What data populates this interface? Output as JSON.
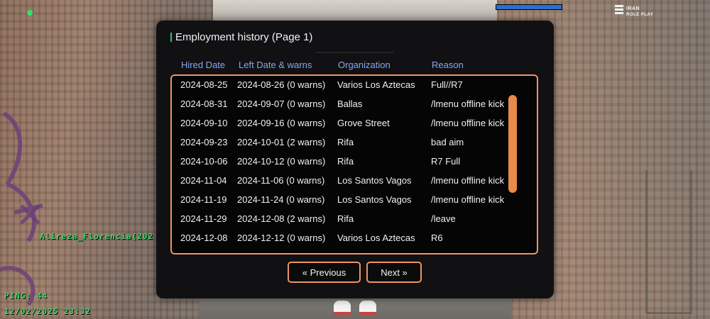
{
  "hud": {
    "player_tag": "Alireza_Florencia(202",
    "ping": "PING: 44",
    "datetime": "12/02/2025 23:32",
    "health_percent": 100,
    "logo_line1": "IRAN",
    "logo_line2": "ROLE PLAY",
    "health_color": "#2b6fd1",
    "hud_text_color": "#3ee06a"
  },
  "dialog": {
    "title": "Employment history (Page 1)",
    "columns": [
      "Hired Date",
      "Left Date & warns",
      "Organization",
      "Reason"
    ],
    "rows": [
      {
        "hired": "2024-08-25",
        "left": "2024-08-26 (0 warns)",
        "org": "Varios Los Aztecas",
        "reason": "Full//R7"
      },
      {
        "hired": "2024-08-31",
        "left": "2024-09-07 (0 warns)",
        "org": "Ballas",
        "reason": "/lmenu offline kick"
      },
      {
        "hired": "2024-09-10",
        "left": "2024-09-16 (0 warns)",
        "org": "Grove Street",
        "reason": "/lmenu offline kick"
      },
      {
        "hired": "2024-09-23",
        "left": "2024-10-01 (2 warns)",
        "org": "Rifa",
        "reason": "bad aim"
      },
      {
        "hired": "2024-10-06",
        "left": "2024-10-12 (0 warns)",
        "org": "Rifa",
        "reason": "R7 Full"
      },
      {
        "hired": "2024-11-04",
        "left": "2024-11-06 (0 warns)",
        "org": "Los Santos Vagos",
        "reason": "/lmenu offline kick"
      },
      {
        "hired": "2024-11-19",
        "left": "2024-11-24 (0 warns)",
        "org": "Los Santos Vagos",
        "reason": "/lmenu offline kick"
      },
      {
        "hired": "2024-11-29",
        "left": "2024-12-08 (2 warns)",
        "org": "Rifa",
        "reason": "/leave"
      },
      {
        "hired": "2024-12-08",
        "left": "2024-12-12 (0 warns)",
        "org": "Varios Los Aztecas",
        "reason": "R6"
      }
    ],
    "prev_label": "« Previous",
    "next_label": "Next »",
    "accent_color": "#ec9565",
    "header_color": "#87a8ea",
    "title_accent_color": "#35c469"
  }
}
